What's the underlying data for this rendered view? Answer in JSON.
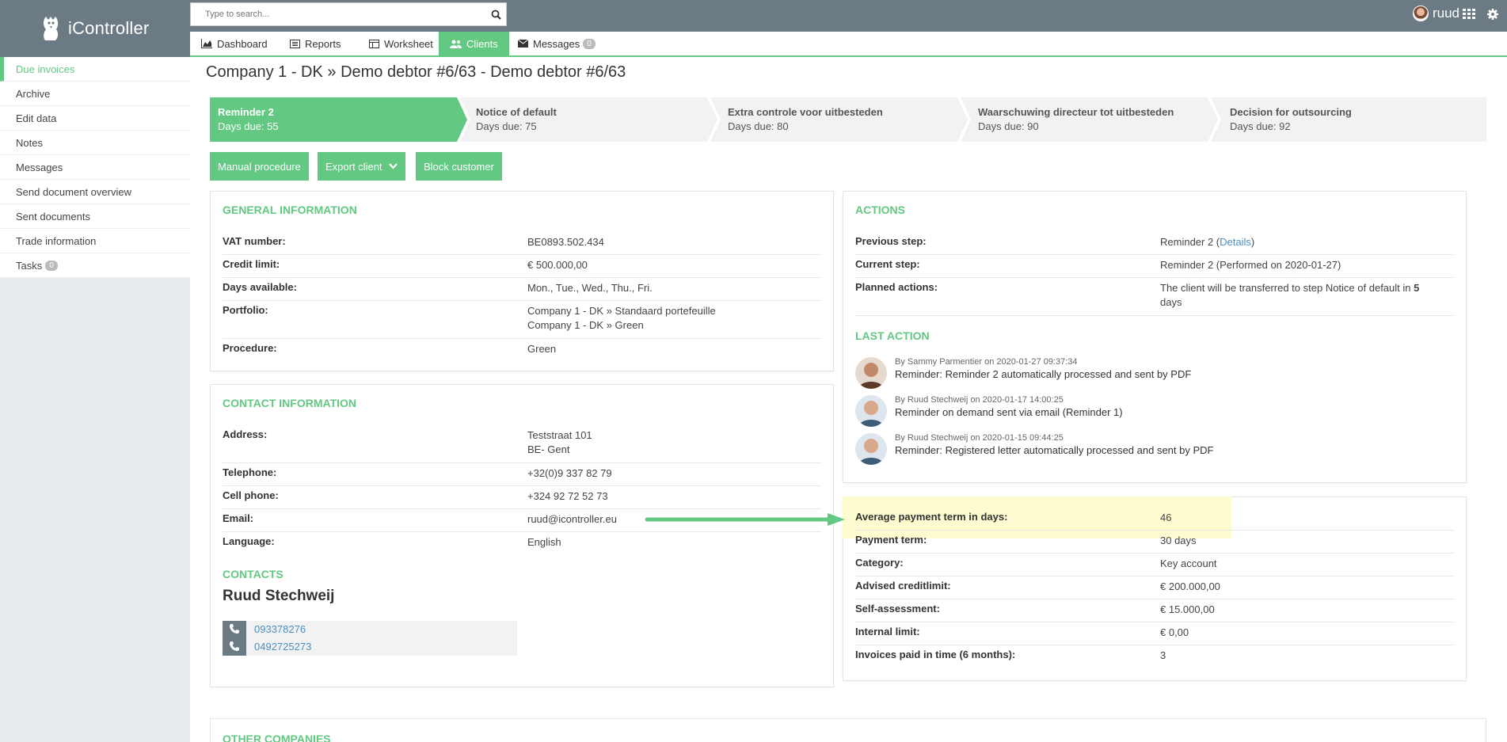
{
  "app": {
    "name": "iController"
  },
  "search": {
    "placeholder": "Type to search..."
  },
  "user": {
    "name": "ruud"
  },
  "nav": {
    "tabs": [
      {
        "label": "Dashboard",
        "icon": "chart-area-icon"
      },
      {
        "label": "Reports",
        "icon": "report-icon"
      },
      {
        "label": "Worksheet",
        "icon": "worksheet-icon"
      },
      {
        "label": "Clients",
        "icon": "users-icon",
        "active": true
      },
      {
        "label": "Messages",
        "icon": "envelope-icon",
        "badge": "0"
      }
    ]
  },
  "sidebar": {
    "items": [
      {
        "label": "Due invoices",
        "active": true
      },
      {
        "label": "Archive"
      },
      {
        "label": "Edit data"
      },
      {
        "label": "Notes"
      },
      {
        "label": "Messages"
      },
      {
        "label": "Send document overview"
      },
      {
        "label": "Sent documents"
      },
      {
        "label": "Trade information"
      },
      {
        "label": "Tasks",
        "badge": "0"
      }
    ]
  },
  "page": {
    "title": "Company 1 - DK » Demo debtor #6/63 - Demo debtor #6/63"
  },
  "steps": [
    {
      "name": "Reminder 2",
      "days": "Days due: 55",
      "active": true
    },
    {
      "name": "Notice of default",
      "days": "Days due: 75"
    },
    {
      "name": "Extra controle voor uitbesteden",
      "days": "Days due: 80"
    },
    {
      "name": "Waarschuwing directeur tot uitbesteden",
      "days": "Days due: 90"
    },
    {
      "name": "Decision for outsourcing",
      "days": "Days due: 92"
    }
  ],
  "buttons": {
    "manual": "Manual procedure",
    "export": "Export client",
    "block": "Block customer"
  },
  "general": {
    "title": "GENERAL INFORMATION",
    "vat_label": "VAT number:",
    "vat": "BE0893.502.434",
    "credit_label": "Credit limit:",
    "credit": "€ 500.000,00",
    "days_label": "Days available:",
    "days": "Mon., Tue., Wed., Thu., Fri.",
    "portfolio_label": "Portfolio:",
    "portfolio_1": "Company 1 - DK » Standaard portefeuille",
    "portfolio_2": "Company 1 - DK » Green",
    "procedure_label": "Procedure:",
    "procedure": "Green"
  },
  "contact": {
    "title": "CONTACT INFORMATION",
    "address_label": "Address:",
    "address_1": "Teststraat 101",
    "address_2": "BE- Gent",
    "tel_label": "Telephone:",
    "tel": "+32(0)9 337 82 79",
    "cell_label": "Cell phone:",
    "cell": "+324 92 72 52 73",
    "email_label": "Email:",
    "email": "ruud@icontroller.eu",
    "lang_label": "Language:",
    "lang": "English",
    "contacts_title": "CONTACTS",
    "person_name": "Ruud Stechweij",
    "phone_1": "093378276",
    "phone_2": "0492725273"
  },
  "actions": {
    "title": "ACTIONS",
    "prev_label": "Previous step:",
    "prev": "Reminder 2 (",
    "prev_link": "Details",
    "prev_end": ")",
    "curr_label": "Current step:",
    "curr": "Reminder 2 (Performed on 2020-01-27)",
    "planned_label": "Planned actions:",
    "planned_1": "The client will be transferred to step Notice of default in ",
    "planned_num": "5",
    "planned_2": "days",
    "last_title": "LAST ACTION",
    "items": [
      {
        "by": "By Sammy Parmentier on 2020-01-27 09:37:34",
        "text": "Reminder: Reminder 2 automatically processed and sent by PDF"
      },
      {
        "by": "By Ruud Stechweij on 2020-01-17 14:00:25",
        "text": "Reminder on demand sent via email (Reminder 1)"
      },
      {
        "by": "By Ruud Stechweij on 2020-01-15 09:44:25",
        "text": "Reminder: Registered letter automatically processed and sent by PDF"
      }
    ]
  },
  "payment": {
    "avg_label": "Average payment term in days:",
    "avg": "46",
    "term_label": "Payment term:",
    "term": "30 days",
    "cat_label": "Category:",
    "cat": "Key account",
    "advised_label": "Advised creditlimit:",
    "advised": "€ 200.000,00",
    "self_label": "Self-assessment:",
    "self": "€ 15.000,00",
    "internal_label": "Internal limit:",
    "internal": "€ 0,00",
    "paid_label": "Invoices paid in time (6 months):",
    "paid": "3"
  },
  "other": {
    "title": "OTHER COMPANIES"
  },
  "colors": {
    "accent": "#62c882",
    "topbar": "#6c7a84",
    "highlight": "#fdfbd0"
  }
}
